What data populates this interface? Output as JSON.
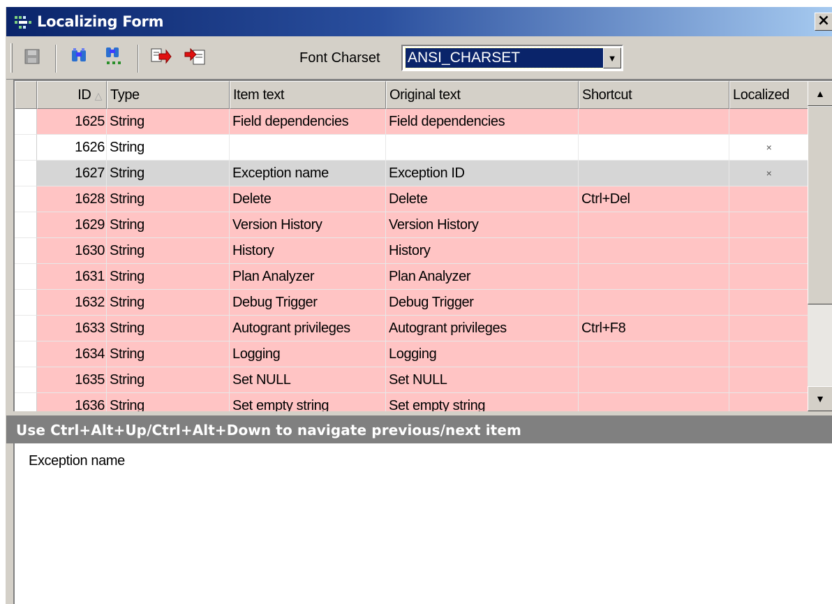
{
  "window": {
    "title": "Localizing Form",
    "close_label": "×"
  },
  "toolbar": {
    "buttons": [
      "save-icon",
      "find-icon",
      "find-next-icon",
      "export-icon",
      "import-icon"
    ],
    "charset_label": "Font Charset",
    "charset_value": "ANSI_CHARSET",
    "charset_dropdown_glyph": "▼"
  },
  "grid": {
    "columns": {
      "id": "ID",
      "id_sort_glyph": "△",
      "type": "Type",
      "item_text": "Item text",
      "original_text": "Original text",
      "shortcut": "Shortcut",
      "localized": "Localized"
    },
    "rows": [
      {
        "id": "1625",
        "type": "String",
        "item_text": "Field dependencies",
        "original_text": "Field dependencies",
        "shortcut": "",
        "localized": "",
        "style": "pink"
      },
      {
        "id": "1626",
        "type": "String",
        "item_text": "",
        "original_text": "",
        "shortcut": "",
        "localized": "×",
        "style": "white"
      },
      {
        "id": "1627",
        "type": "String",
        "item_text": "Exception name",
        "original_text": "Exception ID",
        "shortcut": "",
        "localized": "×",
        "style": "grey"
      },
      {
        "id": "1628",
        "type": "String",
        "item_text": "Delete",
        "original_text": "Delete",
        "shortcut": "Ctrl+Del",
        "localized": "",
        "style": "pink"
      },
      {
        "id": "1629",
        "type": "String",
        "item_text": "Version History",
        "original_text": "Version History",
        "shortcut": "",
        "localized": "",
        "style": "pink"
      },
      {
        "id": "1630",
        "type": "String",
        "item_text": "History",
        "original_text": "History",
        "shortcut": "",
        "localized": "",
        "style": "pink"
      },
      {
        "id": "1631",
        "type": "String",
        "item_text": "Plan Analyzer",
        "original_text": "Plan Analyzer",
        "shortcut": "",
        "localized": "",
        "style": "pink"
      },
      {
        "id": "1632",
        "type": "String",
        "item_text": "Debug Trigger",
        "original_text": "Debug Trigger",
        "shortcut": "",
        "localized": "",
        "style": "pink"
      },
      {
        "id": "1633",
        "type": "String",
        "item_text": "Autogrant privileges",
        "original_text": "Autogrant privileges",
        "shortcut": "Ctrl+F8",
        "localized": "",
        "style": "pink"
      },
      {
        "id": "1634",
        "type": "String",
        "item_text": "Logging",
        "original_text": "Logging",
        "shortcut": "",
        "localized": "",
        "style": "pink"
      },
      {
        "id": "1635",
        "type": "String",
        "item_text": "Set NULL",
        "original_text": "Set NULL",
        "shortcut": "",
        "localized": "",
        "style": "pink"
      },
      {
        "id": "1636",
        "type": "String",
        "item_text": "Set empty string",
        "original_text": "Set empty string",
        "shortcut": "",
        "localized": "",
        "style": "pink"
      }
    ],
    "scroll_up_glyph": "▲",
    "scroll_down_glyph": "▼"
  },
  "statusbar": {
    "hint": "Use Ctrl+Alt+Up/Ctrl+Alt+Down to navigate previous/next item"
  },
  "editor": {
    "value": "Exception name"
  },
  "colors": {
    "row_untranslated": "#ffc4c4",
    "row_selected": "#d6d6d6",
    "title_gradient_start": "#0a246a",
    "title_gradient_end": "#a6caf0",
    "selection": "#0a246a"
  }
}
